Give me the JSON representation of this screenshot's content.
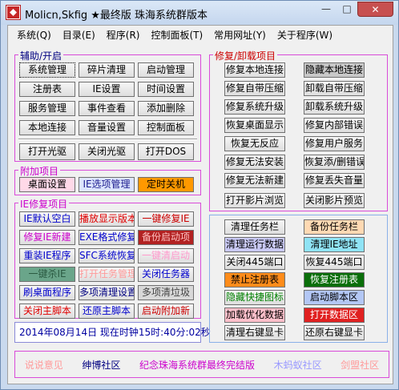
{
  "window": {
    "title": "Molicn,Skfig ★最终版 珠海系统群版本",
    "minimize": "—",
    "maximize": "□",
    "close": "✕"
  },
  "menu": [
    "系统(Q)",
    "目录(E)",
    "程序(R)",
    "控制面板(T)",
    "常用网址(Y)",
    "关于程序(W)"
  ],
  "assist": {
    "title": "辅助/开启",
    "buttons": [
      "系统管理",
      "碎片清理",
      "启动管理",
      "注册表",
      "IE设置",
      "时间设置",
      "服务管理",
      "事件查看",
      "添加删除",
      "本地连接",
      "音量设置",
      "控制面板",
      "打开光驱",
      "关闭光驱",
      "打开DOS"
    ]
  },
  "extra": {
    "title": "附加项目",
    "buttons": [
      "桌面设置",
      "IE选项管理",
      "定时关机"
    ]
  },
  "ie": {
    "title": "IE修复项目",
    "buttons": [
      "IE默认空白",
      "播放显示版本",
      "一键修复IE",
      "修复IE新建",
      "EXE格式修复",
      "备份启动项",
      "重装IE程序",
      "SFC系统恢复",
      "一键清启动",
      "一键杀IE",
      "打开任务管理",
      "关闭任务器",
      "刷桌面程序",
      "多项清理设置",
      "多项清垃圾",
      "关闭主脚本",
      "还原主脚本",
      "启动附加新"
    ]
  },
  "repair": {
    "title": "修复/卸载项目",
    "buttons": [
      "修复本地连接",
      "隐藏本地连接",
      "修复自带压缩",
      "卸载自带压缩",
      "修复系统升级",
      "卸载系统升级",
      "恢复桌面显示",
      "修复内部错误",
      "恢复无反应",
      "修复用户服务",
      "修复无法安装",
      "恢复添/删错误",
      "修复无法新建",
      "修复丢失音量",
      "打开影片浏览",
      "关闭影片预览"
    ]
  },
  "tools": {
    "buttons": [
      "清理任务栏",
      "备份任务栏",
      "清理运行数据",
      "清理IE地址",
      "关闭445端口",
      "恢复445端口",
      "禁止注册表",
      "恢复注册表",
      "隐藏快捷图标",
      "启动脚本区",
      "加载优化数据",
      "打开数据区",
      "清理右键显卡",
      "还原右键显卡"
    ]
  },
  "status": "2014年08月14日  现在时钟15时:40分:02秒",
  "links": [
    "说说意见",
    "绅博社区",
    "纪念珠海系统群最终完结版",
    "木蚂蚁社区",
    "剑盟社区"
  ],
  "colors": {
    "group_border": "#d94bd9",
    "link_blue": "#0000ff",
    "accent_red": "#d0021b"
  }
}
